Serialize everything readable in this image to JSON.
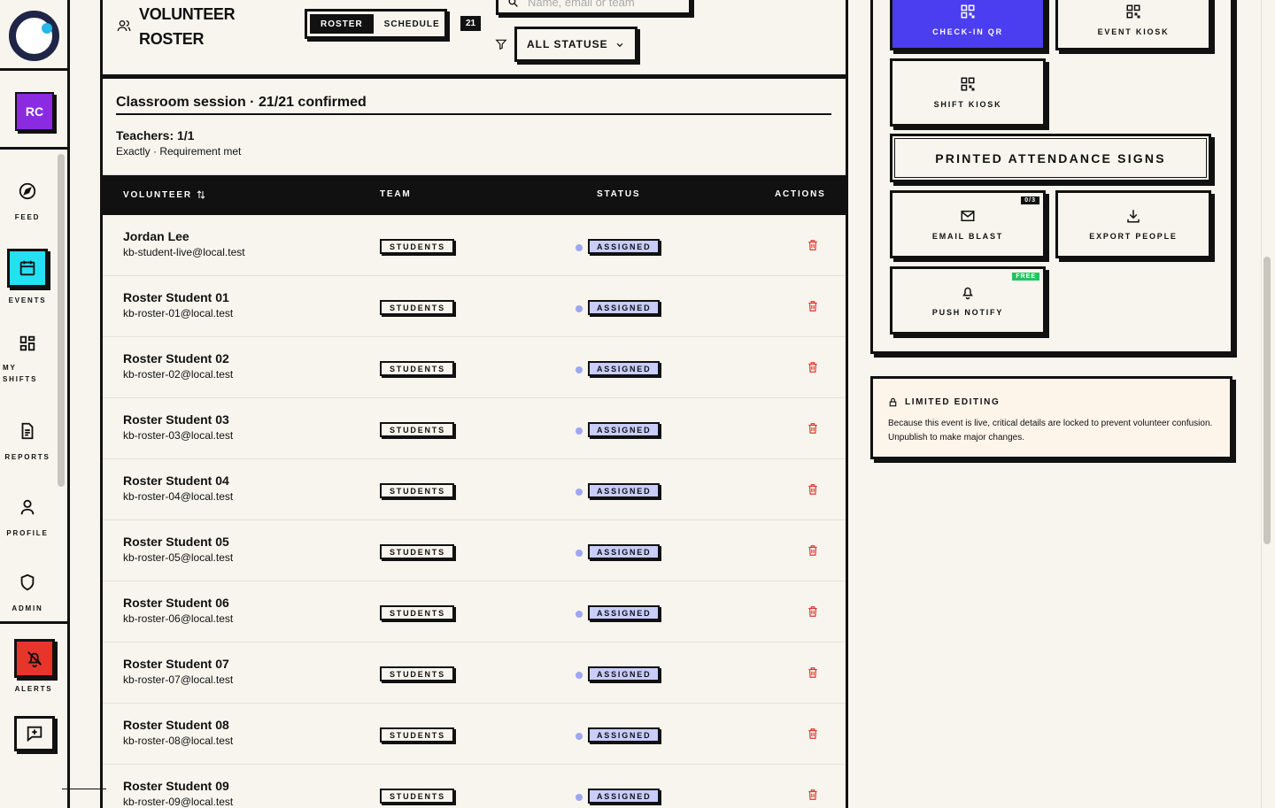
{
  "rail": {
    "avatar_initials": "RC",
    "nav": [
      {
        "label": "FEED",
        "icon": "compass-icon"
      },
      {
        "label": "EVENTS",
        "icon": "calendar-icon",
        "active": true
      },
      {
        "label": "MY SHIFTS",
        "icon": "grid-icon"
      },
      {
        "label": "REPORTS",
        "icon": "document-icon"
      },
      {
        "label": "PROFILE",
        "icon": "user-icon"
      },
      {
        "label": "ADMIN",
        "icon": "shield-icon"
      }
    ],
    "alerts_label": "ALERTS"
  },
  "header": {
    "title": "VOLUNTEER ROSTER",
    "tabs": [
      {
        "label": "ROSTER",
        "active": true
      },
      {
        "label": "SCHEDULE",
        "active": false
      }
    ],
    "count": "21",
    "search_placeholder": "Name, email or team",
    "status_filter": "ALL STATUSES"
  },
  "session": {
    "title": "Classroom session · 21/21 confirmed",
    "requirement": "Teachers: 1/1",
    "requirement_sub": "Exactly · Requirement met"
  },
  "table": {
    "columns": {
      "volunteer": "VOLUNTEER",
      "team": "TEAM",
      "status": "STATUS",
      "actions": "ACTIONS"
    },
    "rows": [
      {
        "name": "Jordan Lee",
        "email": "kb-student-live@local.test",
        "team": "STUDENTS",
        "status": "ASSIGNED"
      },
      {
        "name": "Roster Student 01",
        "email": "kb-roster-01@local.test",
        "team": "STUDENTS",
        "status": "ASSIGNED"
      },
      {
        "name": "Roster Student 02",
        "email": "kb-roster-02@local.test",
        "team": "STUDENTS",
        "status": "ASSIGNED"
      },
      {
        "name": "Roster Student 03",
        "email": "kb-roster-03@local.test",
        "team": "STUDENTS",
        "status": "ASSIGNED"
      },
      {
        "name": "Roster Student 04",
        "email": "kb-roster-04@local.test",
        "team": "STUDENTS",
        "status": "ASSIGNED"
      },
      {
        "name": "Roster Student 05",
        "email": "kb-roster-05@local.test",
        "team": "STUDENTS",
        "status": "ASSIGNED"
      },
      {
        "name": "Roster Student 06",
        "email": "kb-roster-06@local.test",
        "team": "STUDENTS",
        "status": "ASSIGNED"
      },
      {
        "name": "Roster Student 07",
        "email": "kb-roster-07@local.test",
        "team": "STUDENTS",
        "status": "ASSIGNED"
      },
      {
        "name": "Roster Student 08",
        "email": "kb-roster-08@local.test",
        "team": "STUDENTS",
        "status": "ASSIGNED"
      },
      {
        "name": "Roster Student 09",
        "email": "kb-roster-09@local.test",
        "team": "STUDENTS",
        "status": "ASSIGNED"
      }
    ]
  },
  "actions": {
    "checkin_qr": "CHECK-IN QR",
    "event_kiosk": "EVENT KIOSK",
    "shift_kiosk": "SHIFT KIOSK",
    "printed_signs": "PRINTED ATTENDANCE SIGNS",
    "email_blast": "EMAIL BLAST",
    "email_blast_tag": "0/3",
    "export_people": "EXPORT PEOPLE",
    "push_notify": "PUSH NOTIFY",
    "push_notify_tag": "FREE"
  },
  "notice": {
    "title": "LIMITED EDITING",
    "body": "Because this event is live, critical details are locked to prevent volunteer confusion. Unpublish to make major changes."
  },
  "colors": {
    "accent_primary": "#4b3df0",
    "events_active": "#24e0f0",
    "alerts": "#e8352b",
    "avatar": "#8a2be2",
    "status_assigned": "#c8cdfb",
    "free_tag": "#22c55e",
    "trash": "#e0342c"
  }
}
